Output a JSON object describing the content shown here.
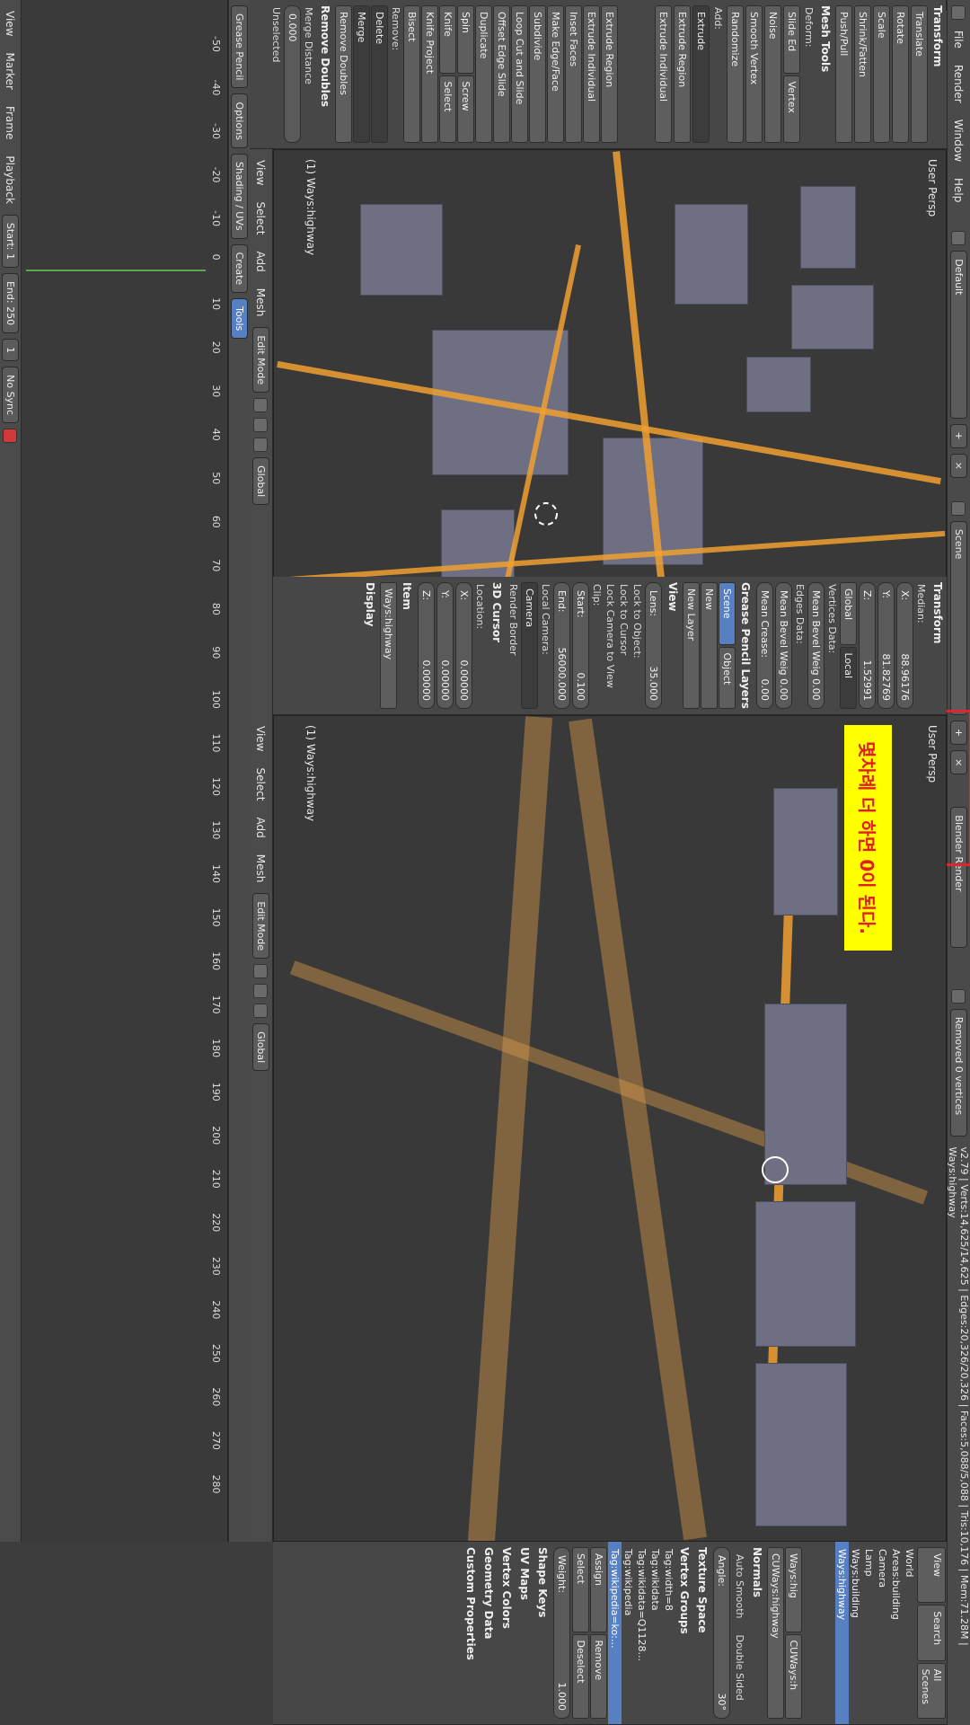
{
  "top_menu": [
    "File",
    "Render",
    "Window",
    "Help"
  ],
  "screen_layout": "Default",
  "scene": "Scene",
  "engine": "Blender Render",
  "status": "Removed 0 vertices",
  "stats": "v2.79 | Verts:14,625/14,625 | Edges:20,326/20,326 | Faces:5,088/5,088 | Tris:10,176 | Mem:71.28M | Ways:highway",
  "tool_tabs": [
    "Grease Pencil",
    "Options",
    "Shading / UVs",
    "Create",
    "Tools"
  ],
  "tools_panel": {
    "transform_title": "Transform",
    "transform": [
      "Translate",
      "Rotate",
      "Scale",
      "Shrink/Fatten",
      "Push/Pull"
    ],
    "mesh_tools_title": "Mesh Tools",
    "deform_label": "Deform:",
    "deform_row": [
      "Slide Ed",
      "Vertex"
    ],
    "deform": [
      "Noise",
      "Smooth Vertex",
      "Randomize"
    ],
    "add_label": "Add:",
    "extrude": "Extrude",
    "add": [
      "Extrude Region",
      "Extrude Individual",
      "Inset Faces",
      "Make Edge/Face",
      "Subdivide",
      "Loop Cut and Slide",
      "Offset Edge Slide",
      "Duplicate"
    ],
    "spin_row": [
      "Spin",
      "Screw"
    ],
    "knife_row": [
      "Knife",
      "Select"
    ],
    "knife_project": "Knife Project",
    "bisect": "Bisect",
    "remove_label": "Remove:",
    "delete": "Delete",
    "merge": "Merge",
    "remove_doubles": "Remove Doubles"
  },
  "remove_doubles_panel": {
    "title": "Remove Doubles",
    "merge_distance_label": "Merge Distance",
    "merge_distance": "0.000",
    "unselected": "Unselected"
  },
  "viewport_left": {
    "persp": "User Persp",
    "object": "(1) Ways:highway"
  },
  "viewport_right": {
    "persp": "User Persp",
    "object": "(1) Ways:highway"
  },
  "note": "몇차례 더 하면 0이 된다.",
  "n_panel": {
    "transform_title": "Transform",
    "median": "Median:",
    "x_label": "X:",
    "x": "88.96176",
    "y_label": "Y:",
    "y": "81.82769",
    "z_label": "Z:",
    "z": "1.52991",
    "global": "Global",
    "local": "Local",
    "vertices_data": "Vertices Data:",
    "mean_bevel_weight_v": "Mean Bevel Weig 0.00",
    "edges_data": "Edges Data:",
    "mean_bevel_weight_e": "Mean Bevel Weig 0.00",
    "mean_crease": "Mean Crease:",
    "mean_crease_val": "0.00",
    "grease_pencil_layers": "Grease Pencil Layers",
    "scene_tab": "Scene",
    "object_tab": "Object",
    "new": "New",
    "new_layer": "New Layer",
    "view_title": "View",
    "lens_label": "Lens:",
    "lens": "35.000",
    "lock_to_object": "Lock to Object:",
    "lock_to_cursor": "Lock to Cursor",
    "lock_camera_to_view": "Lock Camera to View",
    "clip": "Clip:",
    "start_label": "Start:",
    "start": "0.100",
    "end_label": "End:",
    "end": "56000.000",
    "local_camera": "Local Camera:",
    "camera": "Camera",
    "render_border": "Render Border",
    "cursor_title": "3D Cursor",
    "location": "Location:",
    "cx": "0.00000",
    "cy": "0.00000",
    "cz": "0.00000",
    "item_title": "Item",
    "item_name": "Ways:highway",
    "display_title": "Display"
  },
  "header_left": {
    "menus": [
      "View",
      "Select",
      "Add",
      "Mesh"
    ],
    "mode": "Edit Mode",
    "orientation": "Global"
  },
  "header_right": {
    "menus": [
      "View",
      "Select",
      "Add",
      "Mesh"
    ],
    "mode": "Edit Mode",
    "orientation": "Global"
  },
  "timeline": {
    "menus": [
      "View",
      "Marker",
      "Frame",
      "Playback"
    ],
    "start_label": "Start:",
    "start": "1",
    "end_label": "End:",
    "end": "250",
    "current": "1",
    "sync": "No Sync",
    "ticks": [
      "-50",
      "-40",
      "-30",
      "-20",
      "-10",
      "0",
      "10",
      "20",
      "30",
      "40",
      "50",
      "60",
      "70",
      "80",
      "90",
      "100",
      "110",
      "120",
      "130",
      "140",
      "150",
      "160",
      "170",
      "180",
      "190",
      "200",
      "210",
      "220",
      "230",
      "240",
      "250",
      "260",
      "270",
      "280"
    ]
  },
  "outliner": {
    "menus": [
      "View",
      "Search"
    ],
    "scenes": "All Scenes",
    "items": [
      "World",
      "Areas:building",
      "Camera",
      "Lamp",
      "Ways:building",
      "Ways:highway"
    ]
  },
  "properties": {
    "breadcrumb": [
      "Ways:hig",
      "CUWays:h"
    ],
    "mesh_name": "CUWays:highway",
    "normals": "Normals",
    "auto_smooth": "Auto Smooth",
    "double_sided": "Double Sided",
    "angle": "Angle:",
    "angle_val": "30°",
    "texture_space": "Texture Space",
    "vertex_groups": "Vertex Groups",
    "groups": [
      "Tag:width=8",
      "Tag:wikidata",
      "Tag:wikidata=Q1128...",
      "Tag:wikipedia",
      "Tag:wikipedia=ko:..."
    ],
    "assign": "Assign",
    "remove": "Remove",
    "select": "Select",
    "deselect": "Deselect",
    "weight_label": "Weight:",
    "weight": "1.000",
    "shape_keys": "Shape Keys",
    "uv_maps": "UV Maps",
    "vertex_colors": "Vertex Colors",
    "geometry_data": "Geometry Data",
    "custom_properties": "Custom Properties"
  }
}
